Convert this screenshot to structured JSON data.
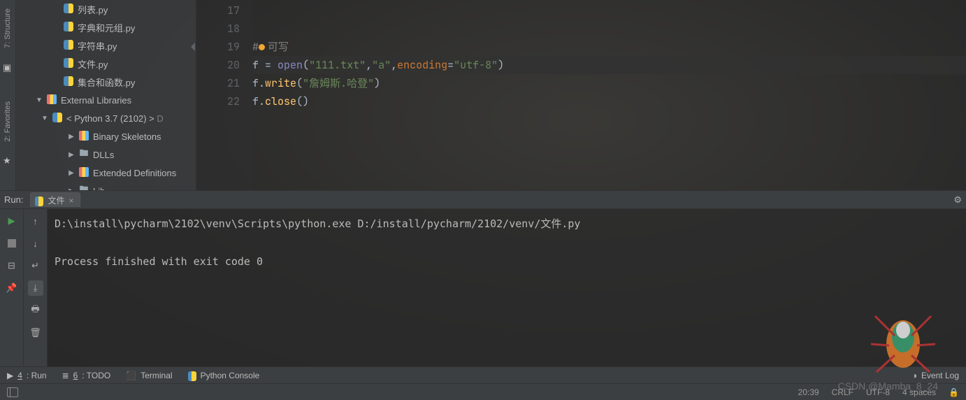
{
  "sidebar": {
    "files": [
      {
        "name": "列表.py"
      },
      {
        "name": "字典和元组.py"
      },
      {
        "name": "字符串.py"
      },
      {
        "name": "文件.py"
      },
      {
        "name": "集合和函数.py"
      }
    ],
    "external_libs_label": "External Libraries",
    "python_env": "< Python 3.7 (2102) >",
    "python_env_suffix": "D",
    "lib_nodes": [
      {
        "name": "Binary Skeletons",
        "icon": "lib"
      },
      {
        "name": "DLLs",
        "icon": "folder"
      },
      {
        "name": "Extended Definitions",
        "icon": "lib"
      },
      {
        "name": "Lib",
        "icon": "folder"
      }
    ]
  },
  "editor": {
    "line_numbers": [
      "17",
      "18",
      "19",
      "20",
      "21",
      "22"
    ],
    "lines": {
      "l17": "",
      "l18": "",
      "l19_comment_prefix": "#",
      "l19_comment_text": "可写",
      "l20_f": "f",
      "l20_eq": " = ",
      "l20_open": "open",
      "l20_p1": "(",
      "l20_s1": "\"111.txt\"",
      "l20_c1": ",",
      "l20_s2": "\"a\"",
      "l20_c2": ",",
      "l20_kw": "encoding",
      "l20_eq2": "=",
      "l20_s3": "\"utf-8\"",
      "l20_p2": ")",
      "l21_f": "f",
      "l21_dot": ".",
      "l21_write": "write",
      "l21_p1": "(",
      "l21_s": "\"詹姆斯.哈登\"",
      "l21_p2": ")",
      "l22_f": "f",
      "l22_dot": ".",
      "l22_close": "close",
      "l22_p": "()"
    }
  },
  "run": {
    "label": "Run:",
    "tab_name": "文件",
    "output_line1": "D:\\install\\pycharm\\2102\\venv\\Scripts\\python.exe D:/install/pycharm/2102/venv/文件.py",
    "output_line2": "Process finished with exit code 0"
  },
  "bottom": {
    "run": {
      "key": "4",
      "label": ": Run"
    },
    "todo": {
      "key": "6",
      "label": ": TODO"
    },
    "terminal": "Terminal",
    "python_console": "Python Console",
    "event_log": "Event Log"
  },
  "status": {
    "time": "20:39",
    "eol": "CRLF",
    "encoding": "UTF-8",
    "indent": "4 spaces"
  },
  "left_strip": {
    "structure": "7: Structure",
    "favorites": "2: Favorites"
  },
  "watermark": "CSDN @Mamba_8_24"
}
